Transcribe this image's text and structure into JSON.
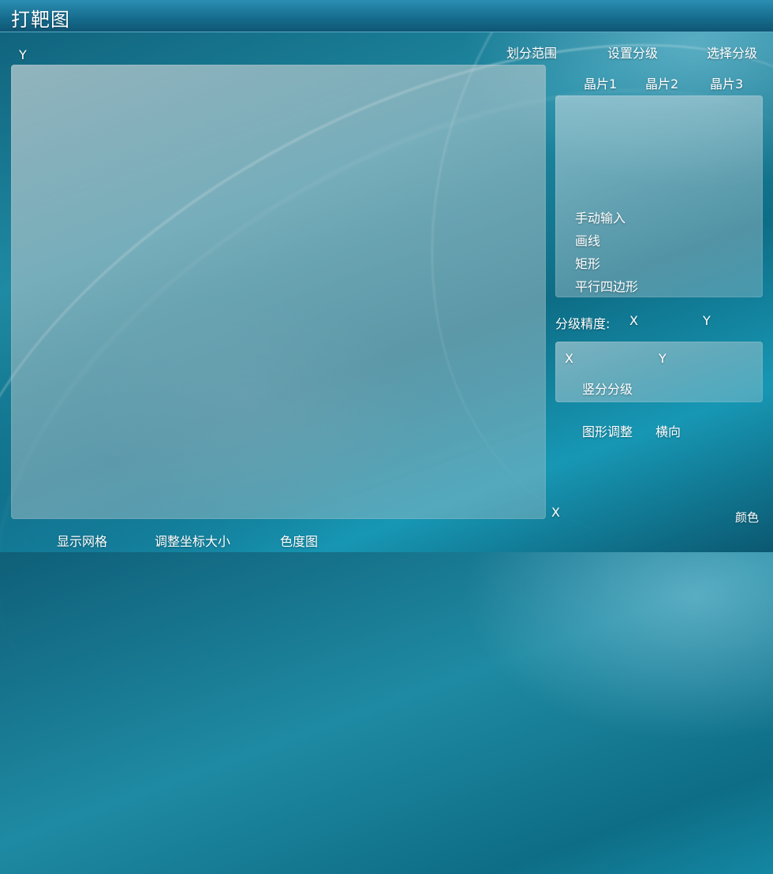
{
  "window": {
    "title": "打靶图"
  },
  "plot": {
    "y_axis_label": "Y",
    "x_axis_label": "X"
  },
  "toolbar_top": {
    "divide_range": "划分范围",
    "set_grading": "设置分级",
    "select_grading": "选择分级"
  },
  "wafer_tabs": [
    "晶片1",
    "晶片2",
    "晶片3"
  ],
  "draw_modes": [
    "手动输入",
    "画线",
    "矩形",
    "平行四边形"
  ],
  "grading": {
    "precision_label": "分级精度:",
    "x_label": "X",
    "y_label": "Y",
    "inner_x": "X",
    "inner_y": "Y",
    "vertical_grading": "竖分分级"
  },
  "adjust": {
    "shape_adjust": "图形调整",
    "horizontal": "横向"
  },
  "color_button": "颜色",
  "bottom_bar": {
    "show_grid": "显示网格",
    "adjust_axis_size": "调整坐标大小",
    "chromaticity": "色度图"
  }
}
